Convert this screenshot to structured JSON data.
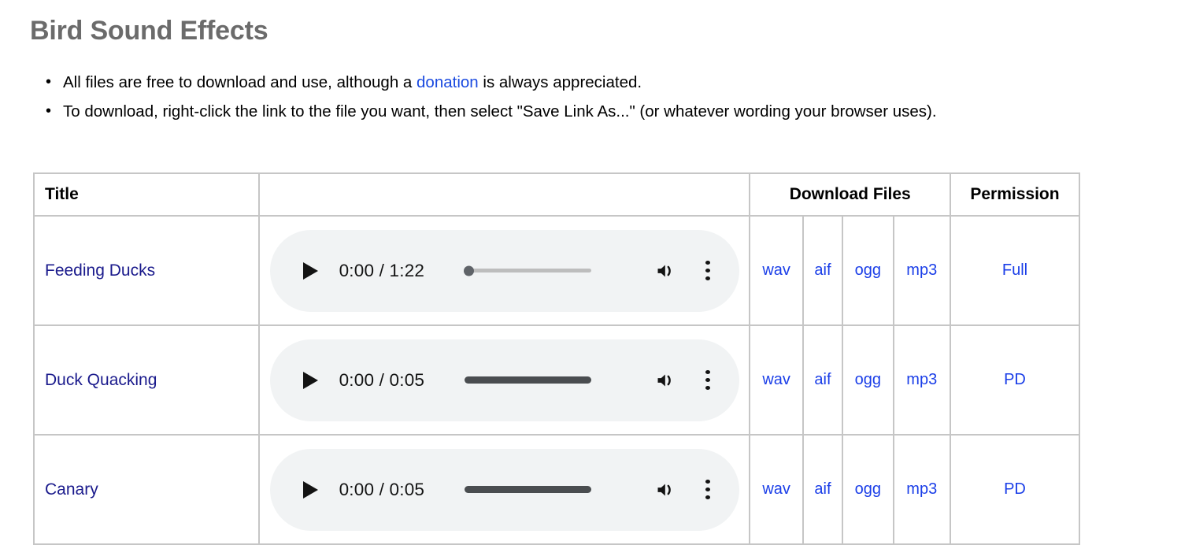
{
  "heading": "Bird Sound Effects",
  "intro": {
    "item1_before": "All files are free to download and use, although a ",
    "item1_link": "donation",
    "item1_after": " is always appreciated.",
    "item2": "To download, right-click the link to the file you want, then select \"Save Link As...\" (or whatever wording your browser uses)."
  },
  "table": {
    "headers": {
      "title": "Title",
      "player": "",
      "downloads": "Download Files",
      "permission": "Permission"
    },
    "rows": [
      {
        "title": "Feeding Ducks",
        "player": {
          "current_time": "0:00",
          "duration": "1:22",
          "time_display": "0:00 / 1:22",
          "progress_percent": 0,
          "bar_style": "empty",
          "play_icon": "play-icon",
          "volume_icon": "volume-icon",
          "menu_icon": "more-vertical-icon"
        },
        "files": [
          "wav",
          "aif",
          "ogg",
          "mp3"
        ],
        "permission": "Full"
      },
      {
        "title": "Duck Quacking",
        "player": {
          "current_time": "0:00",
          "duration": "0:05",
          "time_display": "0:00 / 0:05",
          "progress_percent": 0,
          "bar_style": "full",
          "play_icon": "play-icon",
          "volume_icon": "volume-icon",
          "menu_icon": "more-vertical-icon"
        },
        "files": [
          "wav",
          "aif",
          "ogg",
          "mp3"
        ],
        "permission": "PD"
      },
      {
        "title": "Canary",
        "player": {
          "current_time": "0:00",
          "duration": "0:05",
          "time_display": "0:00 / 0:05",
          "progress_percent": 0,
          "bar_style": "full",
          "play_icon": "play-icon",
          "volume_icon": "volume-icon",
          "menu_icon": "more-vertical-icon"
        },
        "files": [
          "wav",
          "aif",
          "ogg",
          "mp3"
        ],
        "permission": "PD"
      }
    ]
  },
  "colors": {
    "heading": "#6b6b6b",
    "link_bright_blue": "#1a3ee8",
    "link_navy": "#1a1a8c",
    "table_border": "#c6c6c6",
    "player_background": "#f1f3f4",
    "progress_empty": "#bdbdbd",
    "progress_full": "#4a4d50"
  }
}
